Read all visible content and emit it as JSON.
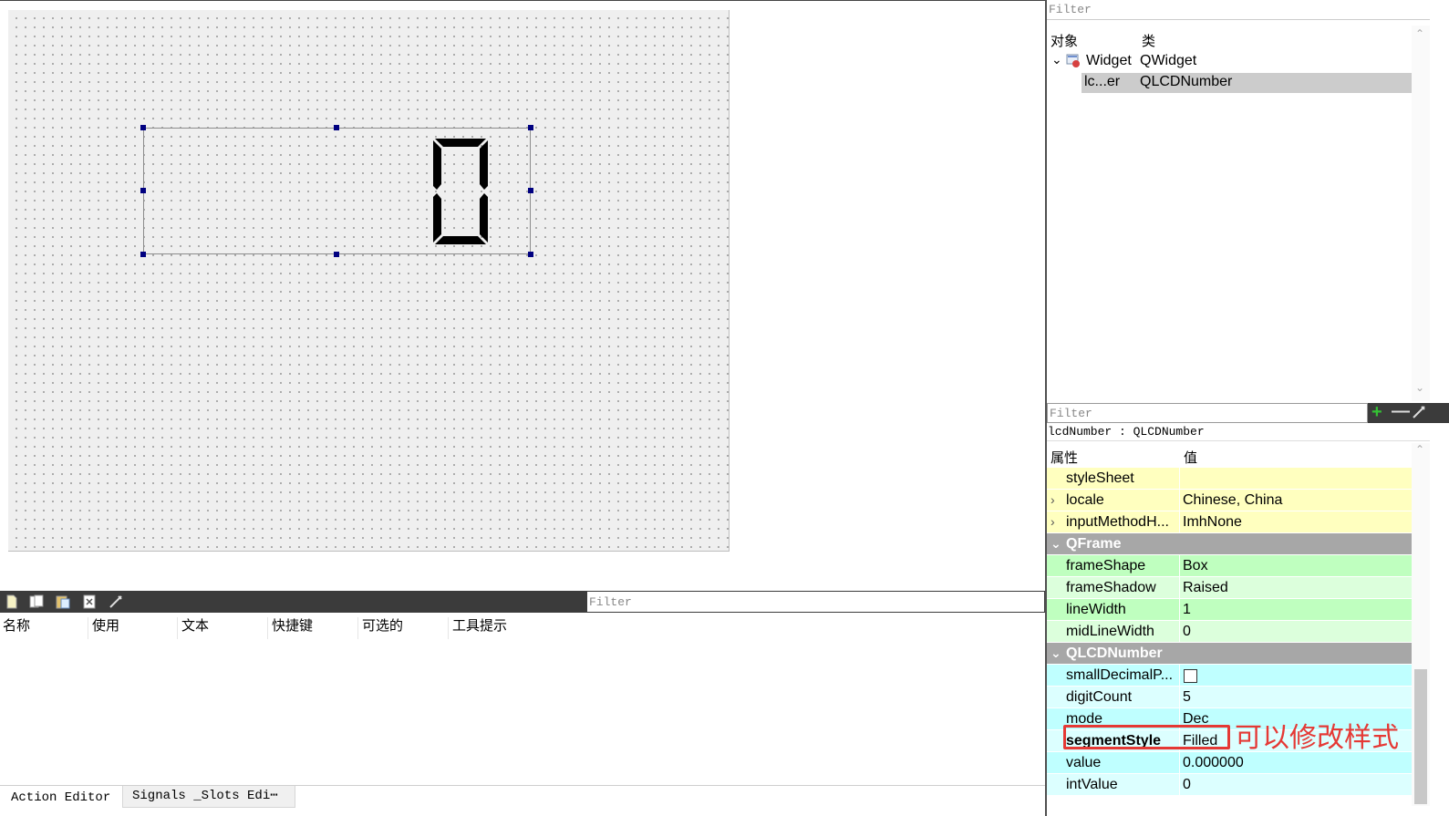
{
  "object_inspector": {
    "filter_placeholder": "Filter",
    "columns": [
      "对象",
      "类"
    ],
    "items": [
      {
        "name": "Widget",
        "class": "QWidget"
      },
      {
        "name": "lc...er",
        "class": "QLCDNumber"
      }
    ]
  },
  "property_editor": {
    "filter_placeholder": "Filter",
    "object_label": "lcdNumber : QLCDNumber",
    "columns": [
      "属性",
      "值"
    ],
    "rows": [
      {
        "name": "styleSheet",
        "value": ""
      },
      {
        "name": "locale",
        "value": "Chinese, China"
      },
      {
        "name": "inputMethodH...",
        "value": "ImhNone"
      }
    ],
    "groups": [
      {
        "name": "QFrame",
        "rows": [
          {
            "name": "frameShape",
            "value": "Box"
          },
          {
            "name": "frameShadow",
            "value": "Raised"
          },
          {
            "name": "lineWidth",
            "value": "1"
          },
          {
            "name": "midLineWidth",
            "value": "0"
          }
        ]
      },
      {
        "name": "QLCDNumber",
        "rows": [
          {
            "name": "smallDecimalP...",
            "value": ""
          },
          {
            "name": "digitCount",
            "value": "5"
          },
          {
            "name": "mode",
            "value": "Dec"
          },
          {
            "name": "segmentStyle",
            "value": "Filled"
          },
          {
            "name": "value",
            "value": "0.000000"
          },
          {
            "name": "intValue",
            "value": "0"
          }
        ]
      }
    ],
    "annotation": "可以修改样式"
  },
  "action_editor": {
    "filter_placeholder": "Filter",
    "columns": [
      "名称",
      "使用",
      "文本",
      "快捷键",
      "可选的",
      "工具提示"
    ],
    "tabs": [
      "Action Editor",
      "Signals _Slots Edi⋯"
    ]
  },
  "lcd": {
    "display_value": "0"
  },
  "colors": {
    "selection_handle": "#000080",
    "annotation_red": "#e53935",
    "add_green": "#34c234"
  }
}
